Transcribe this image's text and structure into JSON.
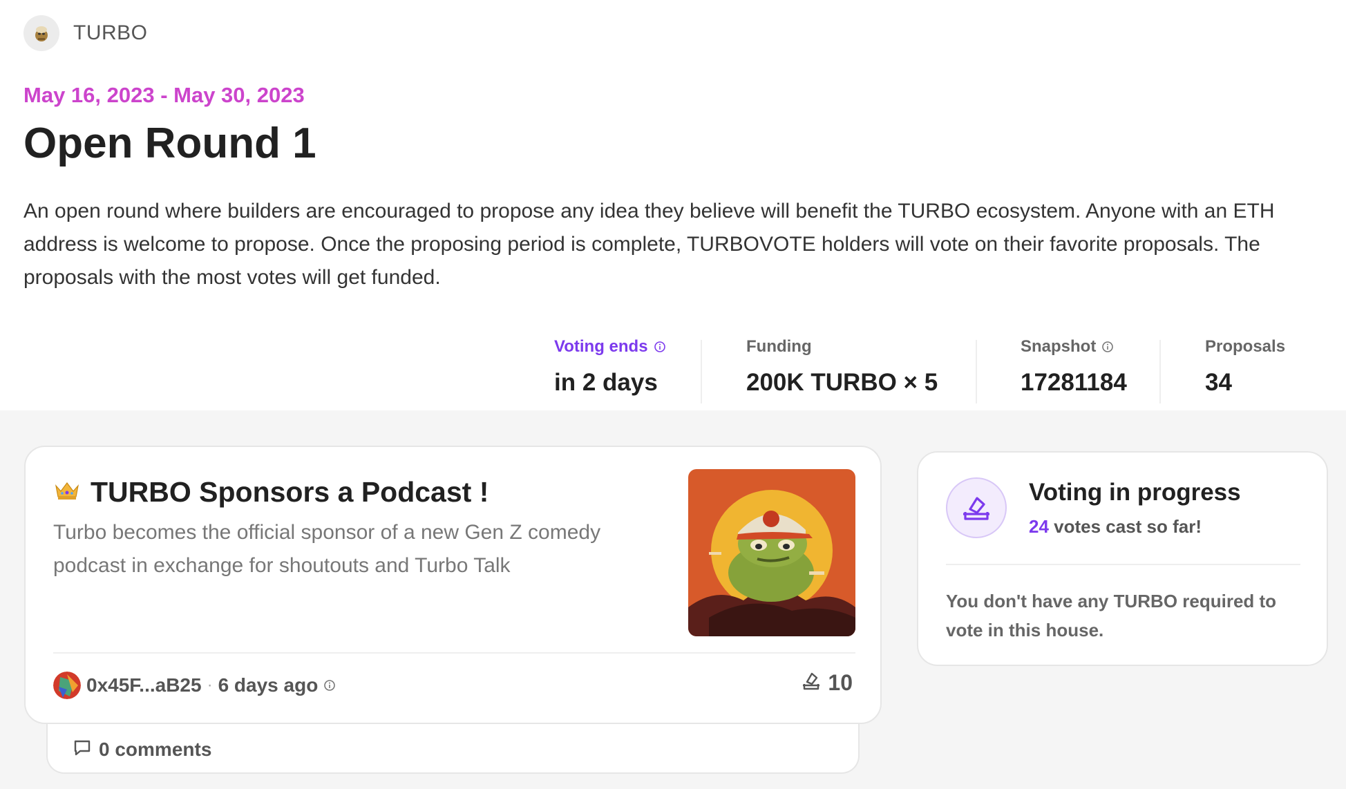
{
  "house": {
    "name": "TURBO"
  },
  "round": {
    "dates": "May 16, 2023 - May 30, 2023",
    "title": "Open Round 1",
    "description": "An open round where builders are encouraged to propose any idea they believe will benefit the TURBO ecosystem. Anyone with an ETH address is welcome to propose. Once the proposing period is complete, TURBOVOTE holders will vote on their favorite proposals. The proposals with the most votes will get funded."
  },
  "stats": {
    "voting_ends": {
      "label": "Voting ends",
      "value": "in 2 days"
    },
    "funding": {
      "label": "Funding",
      "value": "200K TURBO × 5"
    },
    "snapshot": {
      "label": "Snapshot",
      "value": "17281184"
    },
    "proposals": {
      "label": "Proposals",
      "value": "34"
    }
  },
  "proposal": {
    "title": "TURBO Sponsors a Podcast !",
    "description": "Turbo becomes the official sponsor of a new Gen Z comedy podcast in exchange for shoutouts and Turbo Talk",
    "author": "0x45F...aB25",
    "separator": "·",
    "time_ago": "6 days ago",
    "votes": "10",
    "comments": "0 comments"
  },
  "voting_panel": {
    "title": "Voting in progress",
    "votes_num": "24",
    "votes_suffix": " votes cast so far!",
    "message": "You don't have any TURBO required to vote in this house."
  },
  "colors": {
    "accent_purple": "#7c3aed",
    "date_magenta": "#cc44cc",
    "background_gray": "#f5f5f5"
  },
  "icons": [
    "house-avatar-icon",
    "info-icon",
    "crown-icon",
    "frog-thumbnail-image",
    "ballot-icon",
    "comment-icon"
  ]
}
